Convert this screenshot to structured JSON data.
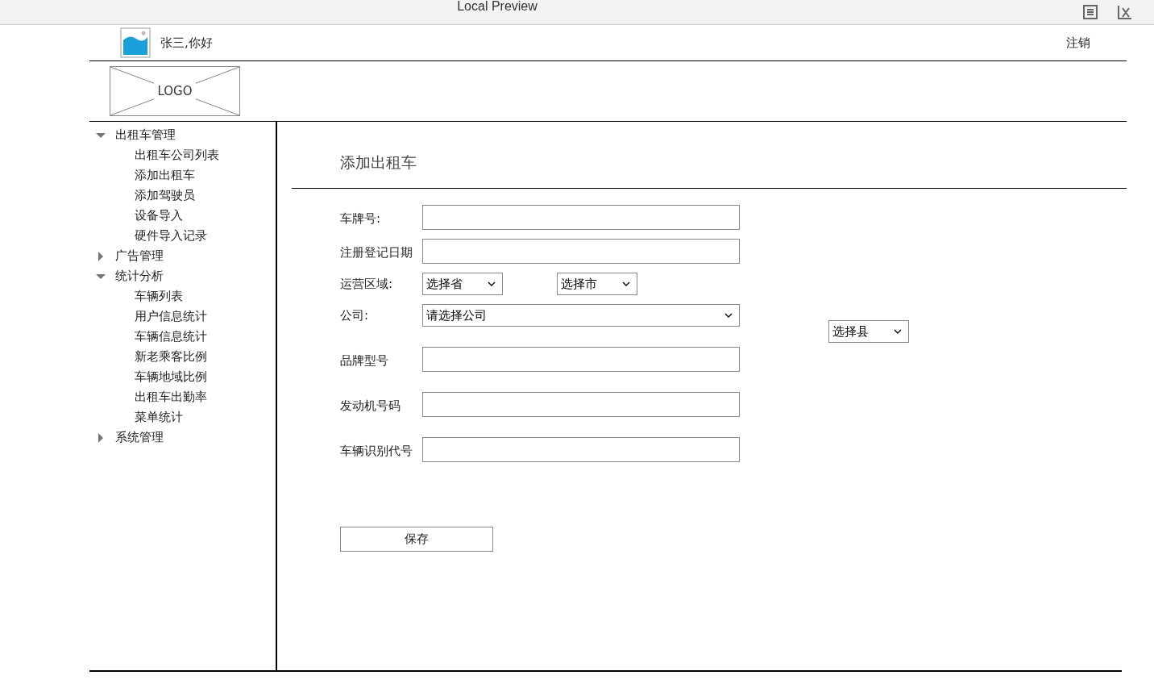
{
  "preview_bar": {
    "title": "Local Preview"
  },
  "header": {
    "greeting": "张三,你好",
    "logout": "注销"
  },
  "logo": {
    "text": "LOGO"
  },
  "sidebar": {
    "items": [
      {
        "label": "出租车管理",
        "expanded": true,
        "children": [
          {
            "label": "出租车公司列表"
          },
          {
            "label": "添加出租车"
          },
          {
            "label": "添加驾驶员"
          },
          {
            "label": "设备导入"
          },
          {
            "label": "硬件导入记录"
          }
        ]
      },
      {
        "label": "广告管理",
        "expanded": false
      },
      {
        "label": "统计分析",
        "expanded": true,
        "children": [
          {
            "label": "车辆列表"
          },
          {
            "label": "用户信息统计"
          },
          {
            "label": "车辆信息统计"
          },
          {
            "label": "新老乘客比例"
          },
          {
            "label": "车辆地域比例"
          },
          {
            "label": "出租车出勤率"
          },
          {
            "label": "菜单统计"
          }
        ]
      },
      {
        "label": "系统管理",
        "expanded": false
      }
    ]
  },
  "page_title": "添加出租车",
  "form": {
    "fields": [
      {
        "label": "车牌号:",
        "kind": "text"
      },
      {
        "label": "注册登记日期",
        "kind": "text"
      },
      {
        "label": "运营区域:",
        "kind": "region",
        "selects": [
          "选择省",
          "选择市"
        ]
      },
      {
        "label": "公司:",
        "kind": "select",
        "value": "请选择公司",
        "extra_select": "选择县"
      },
      {
        "label": "品牌型号",
        "kind": "text"
      },
      {
        "label": "发动机号码",
        "kind": "text"
      },
      {
        "label": "车辆识别代号",
        "kind": "text"
      }
    ],
    "save": "保存"
  }
}
